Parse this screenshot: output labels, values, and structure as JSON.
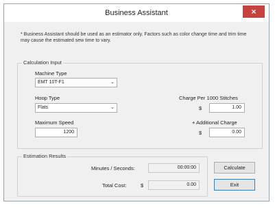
{
  "window": {
    "title": "Business Assistant",
    "close_glyph": "×"
  },
  "note": "* Business Assistant should be used as an estimator only.  Factors such as color change time and trim time may cause the estimated sew time to vary.",
  "calculation_input": {
    "group_title": "Calculation Input",
    "machine_type": {
      "label": "Machine Type",
      "value": "EMT 10T-F1"
    },
    "hoop_type": {
      "label": "Hoop Type",
      "value": "Flats"
    },
    "maximum_speed": {
      "label": "Maximum Speed",
      "value": "1200"
    },
    "charge_per_1000": {
      "label": "Charge Per 1000 Stitches",
      "currency": "$",
      "value": "1.00"
    },
    "additional_charge": {
      "label": "+ Additional Charge",
      "currency": "$",
      "value": "0.00"
    }
  },
  "estimation_results": {
    "group_title": "Estimation Results",
    "minutes_seconds": {
      "label": "Minutes / Seconds:",
      "value": "00:00:00"
    },
    "total_cost": {
      "label": "Total Cost:",
      "currency": "$",
      "value": "0.00"
    }
  },
  "buttons": {
    "calculate": "Calculate",
    "exit": "Exit"
  },
  "icons": {
    "dropdown": "chevron-down-icon",
    "close": "close-icon"
  },
  "colors": {
    "close_button": "#c7433f",
    "window_bg": "#f0f0f0",
    "default_button_border": "#3c7fb1"
  }
}
